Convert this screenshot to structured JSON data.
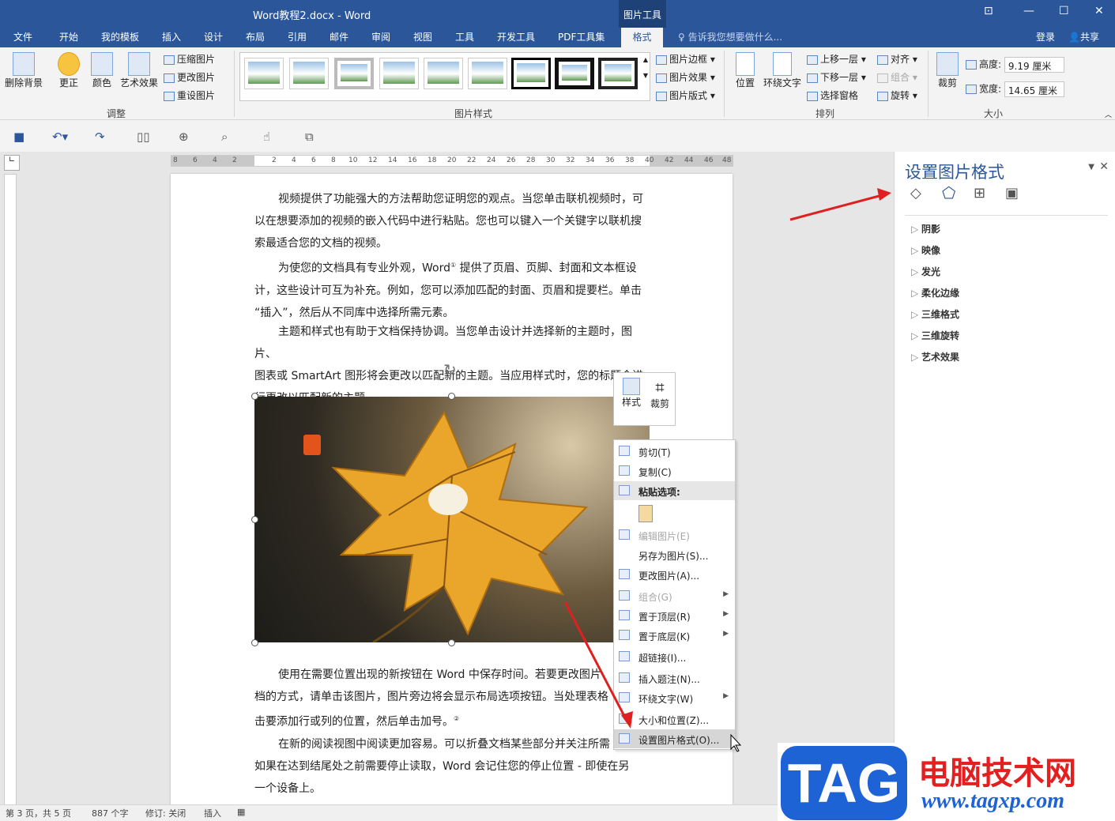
{
  "title": "Word教程2.docx - Word",
  "context_tab": "图片工具",
  "tell_me": "告诉我您想要做什么...",
  "login": "登录",
  "share": "共享",
  "tabs": [
    "文件",
    "开始",
    "我的模板",
    "插入",
    "设计",
    "布局",
    "引用",
    "邮件",
    "审阅",
    "视图",
    "工具",
    "开发工具",
    "PDF工具集"
  ],
  "active_tab": "格式",
  "ribbon": {
    "adjust": {
      "remove_bg": "删除背景",
      "corrections": "更正",
      "color": "颜色",
      "artistic": "艺术效果",
      "compress": "压缩图片",
      "change": "更改图片",
      "reset": "重设图片",
      "label": "调整"
    },
    "styles": {
      "border": "图片边框",
      "effects": "图片效果",
      "layout": "图片版式",
      "label": "图片样式"
    },
    "arrange": {
      "position": "位置",
      "wrap": "环绕文字",
      "forward": "上移一层",
      "backward": "下移一层",
      "selection": "选择窗格",
      "align": "对齐",
      "group": "组合",
      "rotate": "旋转",
      "label": "排列"
    },
    "size": {
      "crop": "裁剪",
      "height_label": "高度:",
      "height_value": "9.19 厘米",
      "width_label": "宽度:",
      "width_value": "14.65 厘米",
      "label": "大小"
    }
  },
  "ruler_numbers": [
    "8",
    "6",
    "4",
    "2",
    "2",
    "4",
    "6",
    "8",
    "10",
    "12",
    "14",
    "16",
    "18",
    "20",
    "22",
    "24",
    "26",
    "28",
    "30",
    "32",
    "34",
    "36",
    "38",
    "40",
    "42",
    "44",
    "46",
    "48"
  ],
  "document": {
    "p1": [
      "视频提供了功能强大的方法帮助您证明您的观点。当您单击联机视频时，可",
      "以在想要添加的视频的嵌入代码中进行粘贴。您也可以键入一个关键字以联机搜",
      "索最适合您的文档的视频。"
    ],
    "p2": [
      "为使您的文档具有专业外观，Word",
      "提供了页眉、页脚、封面和文本框设",
      "计，这些设计可互为补充。例如，您可以添加匹配的封面、页眉和提要栏。单击",
      "“插入”，然后从不同库中选择所需元素。"
    ],
    "p3": [
      "主题和样式也有助于文档保持协调。当您单击设计并选择新的主题时，图片、",
      "图表或 SmartArt 图形将会更改以匹配新的主题。当应用样式时，您的标题会进",
      "行更改以匹配新的主题。"
    ],
    "p4": [
      "使用在需要位置出现的新按钮在 Word 中保存时间。若要更改图片",
      "档的方式，请单击该图片，图片旁边将会显示布局选项按钮。当处理表格",
      "击要添加行或列的位置，然后单击加号。"
    ],
    "p5": [
      "在新的阅读视图中阅读更加容易。可以折叠文档某些部分并关注所需",
      "如果在达到结尾处之前需要停止读取，Word 会记住您的停止位置 - 即使在另",
      "一个设备上。"
    ]
  },
  "mini_toolbar": {
    "style": "样式",
    "crop": "裁剪"
  },
  "context_menu": [
    {
      "label": "剪切(T)",
      "disabled": false,
      "submenu": false
    },
    {
      "label": "复制(C)",
      "disabled": false,
      "submenu": false
    },
    {
      "label": "粘贴选项:",
      "disabled": false,
      "submenu": false,
      "header": true
    },
    {
      "label": "",
      "disabled": false,
      "submenu": false,
      "paste": true
    },
    {
      "label": "编辑图片(E)",
      "disabled": true,
      "submenu": false
    },
    {
      "label": "另存为图片(S)...",
      "disabled": false,
      "submenu": false
    },
    {
      "label": "更改图片(A)...",
      "disabled": false,
      "submenu": false
    },
    {
      "label": "组合(G)",
      "disabled": true,
      "submenu": true
    },
    {
      "label": "置于顶层(R)",
      "disabled": false,
      "submenu": true
    },
    {
      "label": "置于底层(K)",
      "disabled": false,
      "submenu": true
    },
    {
      "label": "超链接(I)...",
      "disabled": false,
      "submenu": false
    },
    {
      "label": "插入题注(N)...",
      "disabled": false,
      "submenu": false
    },
    {
      "label": "环绕文字(W)",
      "disabled": false,
      "submenu": true
    },
    {
      "label": "大小和位置(Z)...",
      "disabled": false,
      "submenu": false
    },
    {
      "label": "设置图片格式(O)...",
      "disabled": false,
      "submenu": false,
      "highlight": true
    }
  ],
  "pane": {
    "title": "设置图片格式",
    "items": [
      "阴影",
      "映像",
      "发光",
      "柔化边缘",
      "三维格式",
      "三维旋转",
      "艺术效果"
    ]
  },
  "status": {
    "page": "第 3 页，共 5 页",
    "words": "887 个字",
    "track": "修订: 关闭",
    "insert": "插入"
  },
  "watermark": {
    "tag": "TAG",
    "cn": "电脑技术网",
    "url": "www.tagxp.com"
  },
  "colors": {
    "brand": "#2b579a",
    "arrow": "#e02020"
  }
}
